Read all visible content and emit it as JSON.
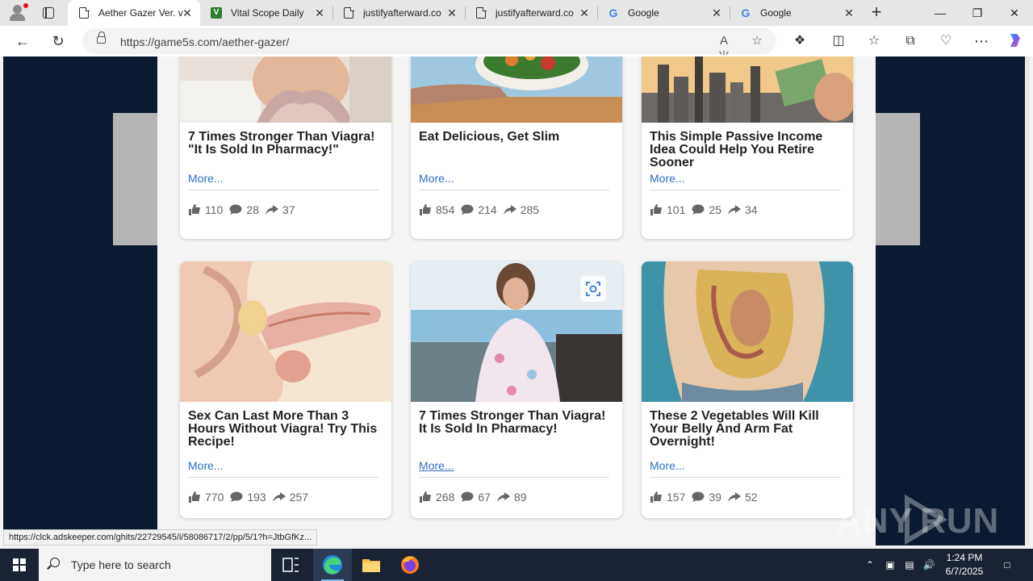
{
  "browser": {
    "tabs": [
      {
        "title": "Aether Gazer Ver. v",
        "icon": "document-icon",
        "active": true
      },
      {
        "title": "Vital Scope Daily",
        "icon": "vital-scope-icon",
        "active": false
      },
      {
        "title": "justifyafterward.co",
        "icon": "document-icon",
        "active": false
      },
      {
        "title": "justifyafterward.co",
        "icon": "document-icon",
        "active": false
      },
      {
        "title": "Google",
        "icon": "google-icon",
        "active": false
      },
      {
        "title": "Google",
        "icon": "google-icon",
        "active": false
      }
    ],
    "url": "https://game5s.com/aether-gazer/",
    "status_url": "https://clck.adskeeper.com/ghits/22729545/i/58086717/2/pp/5/1?h=JtbGfKz..."
  },
  "cards": [
    {
      "title": "7 Times Stronger Than Viagra! \"It Is Sold In Pharmacy!\"",
      "more": "More...",
      "likes": "110",
      "comments": "28",
      "shares": "37"
    },
    {
      "title": "Eat Delicious, Get Slim",
      "more": "More...",
      "likes": "854",
      "comments": "214",
      "shares": "285"
    },
    {
      "title": "This Simple Passive Income Idea Could Help You Retire Sooner",
      "more": "More...",
      "likes": "101",
      "comments": "25",
      "shares": "34"
    },
    {
      "title": "Sex Can Last More Than 3 Hours Without Viagra! Try This Recipe!",
      "more": "More...",
      "likes": "770",
      "comments": "193",
      "shares": "257"
    },
    {
      "title": "7 Times Stronger Than Viagra! It Is Sold In Pharmacy!",
      "more": "More...",
      "likes": "268",
      "comments": "67",
      "shares": "89"
    },
    {
      "title": "These 2 Vegetables Will Kill Your Belly And Arm Fat Overnight!",
      "more": "More...",
      "likes": "157",
      "comments": "39",
      "shares": "52"
    }
  ],
  "watermark": "ANY RUN",
  "taskbar": {
    "search_placeholder": "Type here to search",
    "time": "1:24 PM",
    "date": "6/7/2025"
  },
  "colors": {
    "link": "#2f6fbf",
    "page_background": "#0b1a30",
    "taskbar": "#1a2333"
  }
}
